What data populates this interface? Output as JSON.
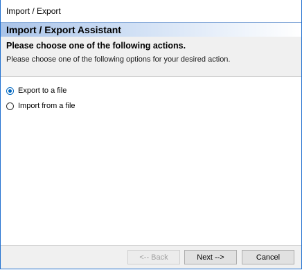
{
  "window": {
    "title": "Import / Export"
  },
  "assistant": {
    "title": "Import / Export Assistant"
  },
  "info": {
    "heading": "Please choose one of the following actions.",
    "description": "Please choose one of the following options for your desired action."
  },
  "options": [
    {
      "label": "Export to a file",
      "selected": true
    },
    {
      "label": "Import from a file",
      "selected": false
    }
  ],
  "buttons": {
    "back": "<-- Back",
    "next": "Next -->",
    "cancel": "Cancel"
  },
  "colors": {
    "accent": "#0067c0",
    "banner": "#a9c3e8",
    "window_border": "#1f6fd0"
  }
}
